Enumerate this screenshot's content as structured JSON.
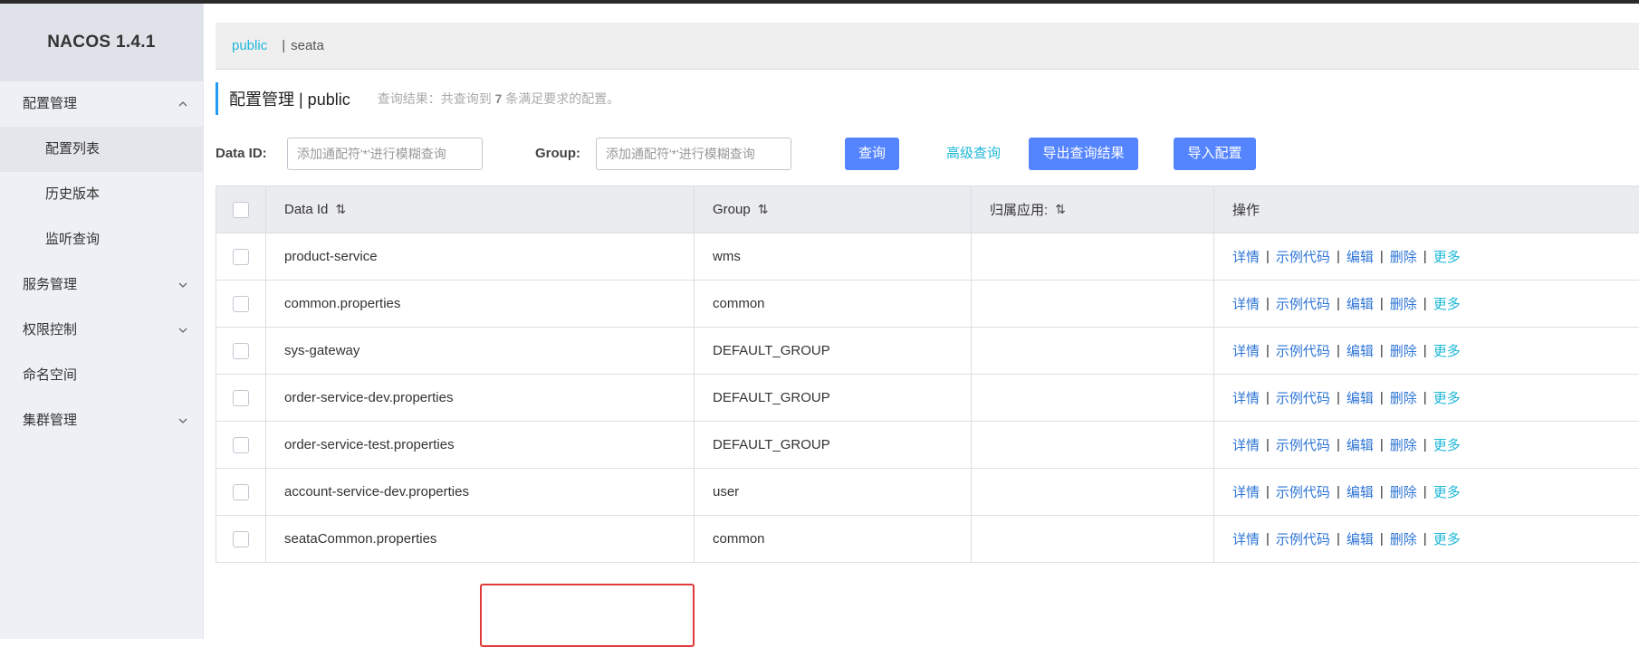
{
  "app": {
    "title": "NACOS 1.4.1"
  },
  "sidebar": {
    "items": [
      {
        "label": "配置管理",
        "expanded": true,
        "children": [
          {
            "label": "配置列表",
            "active": true
          },
          {
            "label": "历史版本",
            "active": false
          },
          {
            "label": "监听查询",
            "active": false
          }
        ]
      },
      {
        "label": "服务管理",
        "expanded": false
      },
      {
        "label": "权限控制",
        "expanded": false
      },
      {
        "label": "命名空间"
      },
      {
        "label": "集群管理",
        "expanded": false
      }
    ]
  },
  "namespace_bar": {
    "active": "public",
    "separator": "|",
    "other": "seata"
  },
  "page": {
    "title": "配置管理 | public",
    "summary_prefix": "查询结果：共查询到",
    "summary_count": "7",
    "summary_suffix": "条满足要求的配置。"
  },
  "search": {
    "dataid_label": "Data ID:",
    "dataid_placeholder": "添加通配符'*'进行模糊查询",
    "group_label": "Group:",
    "group_placeholder": "添加通配符'*'进行模糊查询",
    "query_button": "查询",
    "advanced_link": "高级查询",
    "export_button": "导出查询结果",
    "import_button": "导入配置"
  },
  "table": {
    "headers": {
      "data_id": "Data Id",
      "group": "Group",
      "app": "归属应用:",
      "ops": "操作"
    },
    "sort_icon": "⇅",
    "ops": {
      "detail": "详情",
      "sample": "示例代码",
      "edit": "编辑",
      "delete": "删除",
      "more": "更多",
      "sep": "|"
    },
    "rows": [
      {
        "data_id": "product-service",
        "group": "wms",
        "app": ""
      },
      {
        "data_id": "common.properties",
        "group": "common",
        "app": ""
      },
      {
        "data_id": "sys-gateway",
        "group": "DEFAULT_GROUP",
        "app": ""
      },
      {
        "data_id": "order-service-dev.properties",
        "group": "DEFAULT_GROUP",
        "app": ""
      },
      {
        "data_id": "order-service-test.properties",
        "group": "DEFAULT_GROUP",
        "app": ""
      },
      {
        "data_id": "account-service-dev.properties",
        "group": "user",
        "app": ""
      },
      {
        "data_id": "seataCommon.properties",
        "group": "common",
        "app": ""
      }
    ]
  },
  "colors": {
    "primary_button": "#5584ff",
    "link": "#2e75d6",
    "accent_link": "#1eb8d8",
    "highlight": "#e03a3a"
  }
}
